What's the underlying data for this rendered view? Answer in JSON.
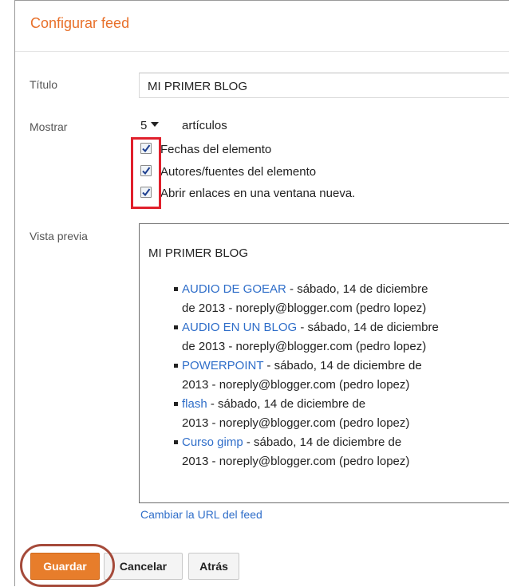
{
  "dialog": {
    "title": "Configurar feed"
  },
  "form": {
    "title_label": "Título",
    "title_value": "MI PRIMER BLOG",
    "show_label": "Mostrar",
    "show_count": "5",
    "articles_label": "artículos",
    "options": [
      {
        "label": "Fechas del elemento",
        "checked": true
      },
      {
        "label": "Autores/fuentes del elemento",
        "checked": true
      },
      {
        "label": "Abrir enlaces en una ventana nueva.",
        "checked": true
      }
    ],
    "preview_label": "Vista previa"
  },
  "preview": {
    "feed_title": "MI PRIMER BLOG",
    "items": [
      {
        "link": "AUDIO DE GOEAR",
        "line1": " - sábado, 14 de diciembre",
        "line2": "de 2013 - noreply@blogger.com (pedro lopez)"
      },
      {
        "link": "AUDIO EN UN BLOG",
        "line1": " - sábado, 14 de diciembre",
        "line2": "de 2013 - noreply@blogger.com (pedro lopez)"
      },
      {
        "link": "POWERPOINT",
        "line1": " - sábado, 14 de diciembre de",
        "line2": "2013 - noreply@blogger.com (pedro lopez)"
      },
      {
        "link": "flash",
        "line1": " - sábado, 14 de diciembre de",
        "line2": "2013 - noreply@blogger.com (pedro lopez)"
      },
      {
        "link": "Curso gimp",
        "line1": " - sábado, 14 de diciembre de",
        "line2": "2013 - noreply@blogger.com (pedro lopez)"
      }
    ]
  },
  "links": {
    "change_feed_url": "Cambiar la URL del feed"
  },
  "buttons": {
    "save": "Guardar",
    "cancel": "Cancelar",
    "back": "Atrás"
  },
  "colors": {
    "accent_orange": "#e77d2b",
    "title_orange": "#e8702a",
    "link_blue": "#2f6ec9",
    "highlight_red": "#e0202c",
    "ring_brown": "#a54a3a"
  },
  "icons": {
    "dropdown": "chevron-down-icon",
    "checkbox": "check-icon"
  }
}
